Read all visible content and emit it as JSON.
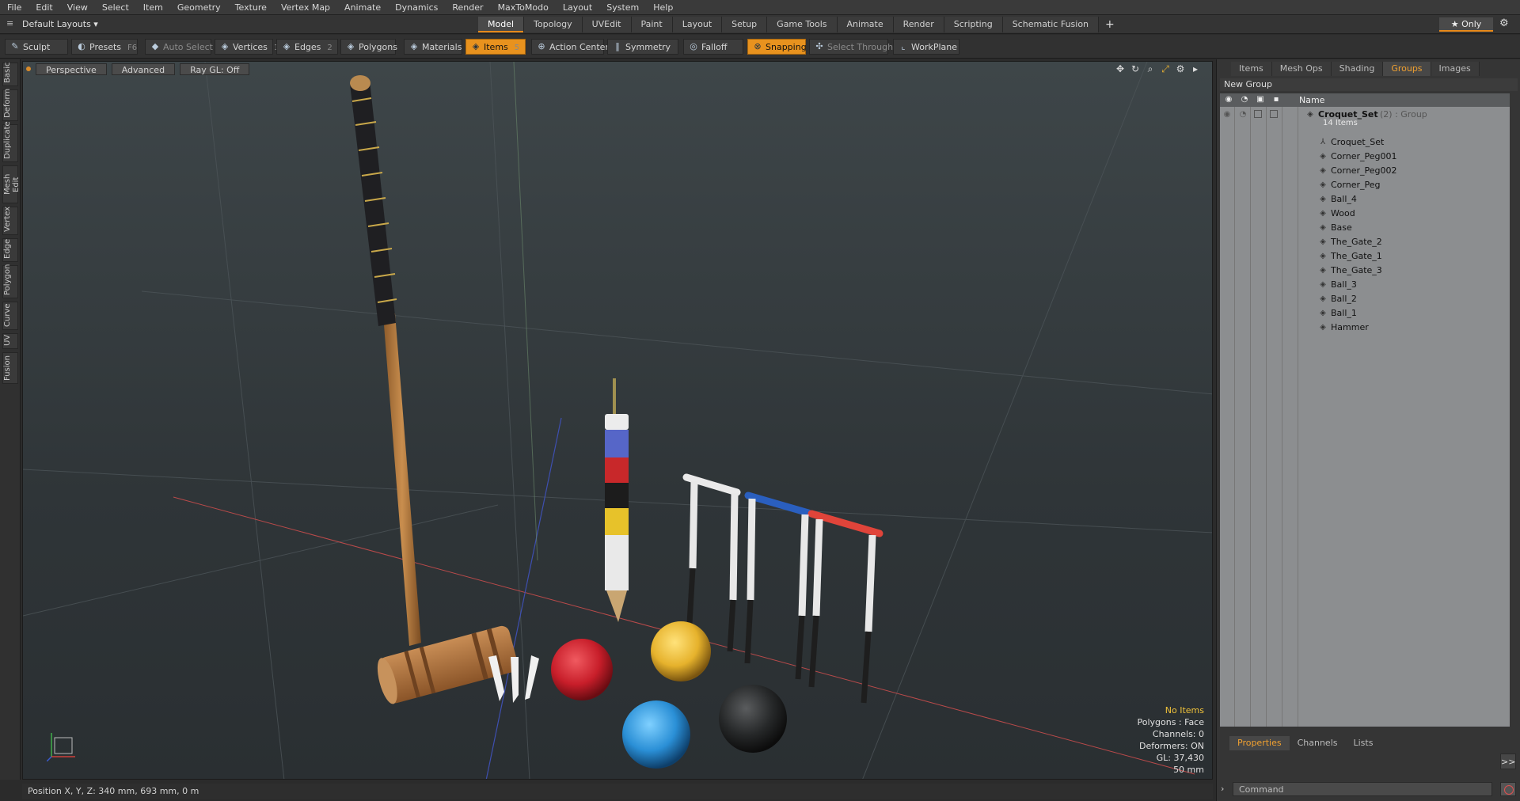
{
  "menu": [
    "File",
    "Edit",
    "View",
    "Select",
    "Item",
    "Geometry",
    "Texture",
    "Vertex Map",
    "Animate",
    "Dynamics",
    "Render",
    "MaxToModo",
    "Layout",
    "System",
    "Help"
  ],
  "layout_select": "Default Layouts ▾",
  "mode_tabs": [
    "Model",
    "Topology",
    "UVEdit",
    "Paint",
    "Layout",
    "Setup",
    "Game Tools",
    "Animate",
    "Render",
    "Scripting",
    "Schematic Fusion"
  ],
  "active_mode": "Model",
  "plus": "+",
  "only_label": "★ Only",
  "toolbar": {
    "sculpt": "Sculpt",
    "presets": "Presets",
    "presets_key": "F6",
    "auto_select": "Auto Select",
    "vertices": "Vertices",
    "vertices_key": "1",
    "edges": "Edges",
    "edges_key": "2",
    "polygons": "Polygons",
    "materials": "Materials",
    "items": "Items",
    "items_key": "5",
    "action_center": "Action Center",
    "symmetry": "Symmetry",
    "falloff": "Falloff",
    "snapping": "Snapping",
    "select_through": "Select Through",
    "workplane": "WorkPlane"
  },
  "left_tabs": [
    "Basic",
    "Deform",
    "Duplicate",
    "Mesh Edit",
    "Vertex",
    "Edge",
    "Polygon",
    "Curve",
    "UV",
    "Fusion"
  ],
  "viewport": {
    "view": "Perspective",
    "shading": "Advanced",
    "raygl": "Ray GL: Off",
    "info": {
      "items": "No Items",
      "polygons": "Polygons : Face",
      "channels": "Channels: 0",
      "deformers": "Deformers: ON",
      "gl": "GL: 37,430",
      "scale": "50 mm"
    }
  },
  "status": "Position X, Y, Z:   340 mm, 693 mm, 0 m",
  "right_panel": {
    "tabs": [
      "Items",
      "Mesh Ops",
      "Shading",
      "Groups",
      "Images"
    ],
    "active_tab": "Groups",
    "new_group": "New Group",
    "name_header": "Name",
    "group_name": "Croquet_Set",
    "group_suffix": "(2) : Group",
    "group_count": "14 Items",
    "children": [
      "Croquet_Set",
      "Corner_Peg001",
      "Corner_Peg002",
      "Corner_Peg",
      "Ball_4",
      "Wood",
      "Base",
      "The_Gate_2",
      "The_Gate_1",
      "The_Gate_3",
      "Ball_3",
      "Ball_2",
      "Ball_1",
      "Hammer"
    ],
    "bottom_tabs": [
      "Properties",
      "Channels",
      "Lists"
    ],
    "active_bottom": "Properties",
    "command_placeholder": "Command",
    "expand": ">>"
  },
  "colors": {
    "accent": "#e8921e",
    "ball_red": "#d42a35",
    "ball_yellow": "#e8b930",
    "ball_blue": "#2a8fd6",
    "ball_black": "#232526"
  }
}
